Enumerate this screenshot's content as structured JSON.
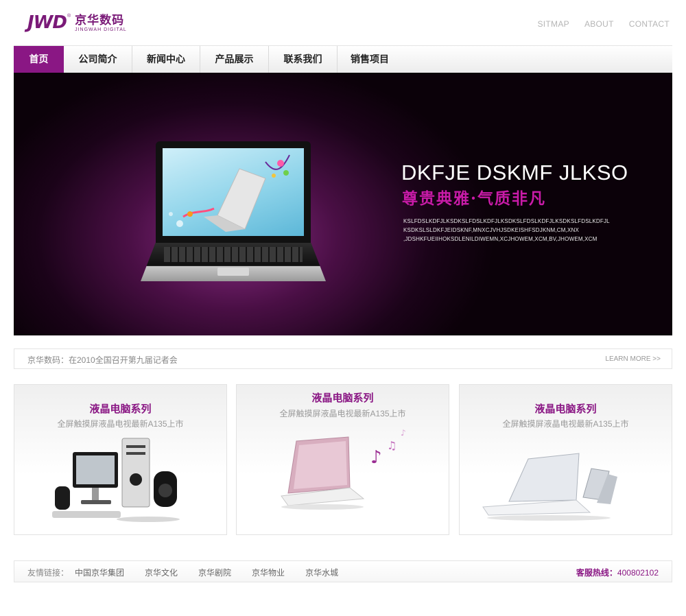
{
  "logo": {
    "mark": "JWD",
    "reg": "®",
    "cn": "京华数码",
    "en": "JINGWAH DIGITAL"
  },
  "top_links": [
    "SITMAP",
    "ABOUT",
    "CONTACT"
  ],
  "nav": {
    "active_index": 0,
    "items": [
      "首页",
      "公司简介",
      "新闻中心",
      "产品展示",
      "联系我们",
      "销售项目"
    ]
  },
  "banner": {
    "title": "DKFJE DSKMF JLKSO",
    "slogan": "尊贵典雅·气质非凡",
    "desc_lines": [
      "KSLFDSLKDFJLKSDKSLFDSLKDFJLKSDKSLFDSLKDFJLKSDKSLFDSLKDFJL",
      "KSDKSLSLDKFJEIDSKNF,MNXCJVHJSDKEISHFSDJKNM,CM,XNX",
      ",JDSHKFUEIIHOKSDLENILDIWEMN,XCJHOWEM,XCM,BV,JHOWEM,XCM"
    ]
  },
  "news": {
    "text": "京华数码：在2010全国召开第九届记者会",
    "learn_more": "LEARN MORE >>"
  },
  "products": [
    {
      "title": "液晶电脑系列",
      "subtitle": "全屏触摸屏液晶电视最新A135上市"
    },
    {
      "title": "液晶电脑系列",
      "subtitle": "全屏触摸屏液晶电视最新A135上市"
    },
    {
      "title": "液晶电脑系列",
      "subtitle": "全屏触摸屏液晶电视最新A135上市"
    }
  ],
  "footer": {
    "friend_label": "友情链接：",
    "links": [
      "中国京华集团",
      "京华文化",
      "京华剧院",
      "京华物业",
      "京华水城"
    ],
    "hotline_label": "客服热线：",
    "hotline_number": "400802102"
  },
  "colors": {
    "brand": "#8a1784",
    "muted": "#b5b5b5"
  }
}
